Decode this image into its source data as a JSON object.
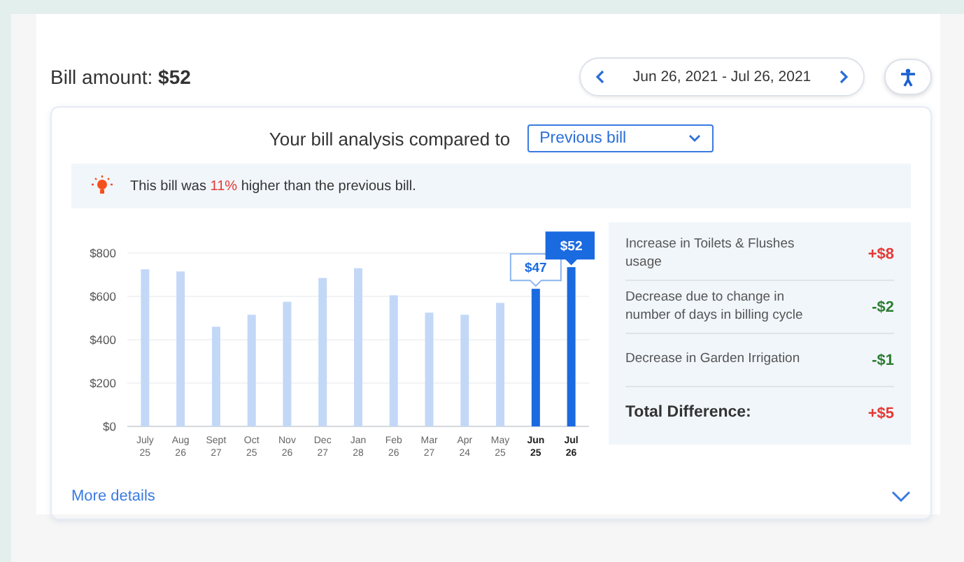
{
  "header": {
    "label": "Bill amount:",
    "amount": "$52"
  },
  "date_range": {
    "text": "Jun 26, 2021 - Jul 26, 2021"
  },
  "analysis": {
    "label": "Your bill analysis compared to",
    "dropdown_value": "Previous bill"
  },
  "notice": {
    "before": "This bill was",
    "highlight": "11%",
    "after": "higher than the previous bill."
  },
  "chart_data": {
    "type": "bar",
    "stacked": true,
    "grid": true,
    "categories": [
      "July 25",
      "Aug 26",
      "Sept 27",
      "Oct 25",
      "Nov 26",
      "Dec 27",
      "Jan 28",
      "Feb 26",
      "Mar 27",
      "Apr 24",
      "May 25",
      "Jun 25",
      "Jul 26"
    ],
    "series": [
      {
        "color": "#c3d8f7",
        "values": [
          725,
          715,
          460,
          515,
          575,
          685,
          730,
          605,
          525,
          515,
          570,
          null,
          null
        ]
      },
      {
        "color": "#1a6ae0",
        "values": [
          null,
          null,
          null,
          null,
          null,
          null,
          null,
          null,
          null,
          null,
          null,
          635,
          735
        ]
      }
    ],
    "ylim": [
      0,
      800
    ],
    "yticks": [
      {
        "value": 0,
        "label": "$0"
      },
      {
        "value": 200,
        "label": "$200"
      },
      {
        "value": 400,
        "label": "$400"
      },
      {
        "value": 600,
        "label": "$600"
      },
      {
        "value": 800,
        "label": "$800"
      }
    ],
    "annotations": [
      {
        "x": "Jun 25",
        "y": 635,
        "text": "$47"
      },
      {
        "x": "Jul 26",
        "y": 735,
        "text": "$52"
      }
    ]
  },
  "breakdown": [
    {
      "text": "Increase in Toilets & Flushes usage",
      "amount": "+$8",
      "kind": "increase"
    },
    {
      "text": "Decrease due to change in number of days in billing cycle",
      "amount": "-$2",
      "kind": "decrease"
    },
    {
      "text": "Decrease in Garden Irrigation",
      "amount": "-$1",
      "kind": "decrease"
    }
  ],
  "total": {
    "label": "Total Difference:",
    "amount": "+$5",
    "kind": "increase"
  },
  "more_details": {
    "text": "More details",
    "expanded": false
  }
}
